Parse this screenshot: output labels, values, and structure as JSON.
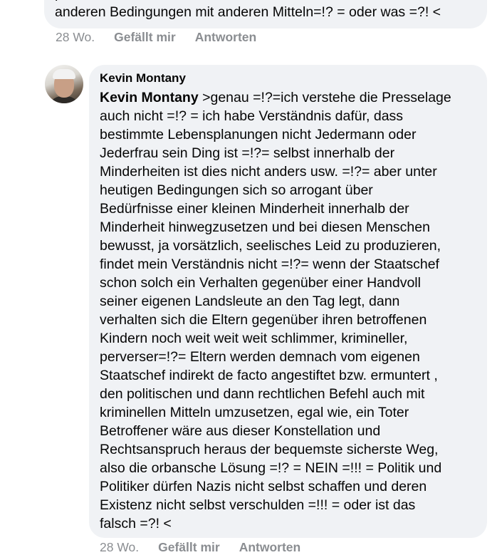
{
  "previous_comment": {
    "hidden_line": "p",
    "visible_line": "anderen Bedingungen mit anderen Mitteln=!? = oder was =?! <",
    "time": "28 Wo.",
    "like_label": "Gefällt mir",
    "reply_label": "Antworten"
  },
  "comment": {
    "author": "Kevin Montany",
    "mention": "Kevin Montany",
    "text": " >genau =!?=ich verstehe die Presselage\nauch nicht =!? = ich habe Verständnis dafür, dass\nbestimmte Lebensplanungen nicht Jedermann oder\nJederfrau sein Ding ist =!?= selbst innerhalb der\nMinderheiten ist dies nicht anders usw. =!?= aber  unter\nheutigen Bedingungen sich so arrogant über\nBedürfnisse einer kleinen Minderheit innerhalb der\nMinderheit hinwegzusetzen und bei diesen Menschen\nbewusst, ja  vorsätzlich, seelisches Leid zu produzieren,\nfindet mein Verständnis nicht =!?= wenn der Staatschef\nschon solch ein Verhalten gegenüber einer Handvoll\nseiner eigenen  Landsleute an den Tag legt, dann\nverhalten sich die Eltern gegenüber ihren betroffenen\nKindern noch weit weit weit schlimmer, krimineller,\nperverser=!?= Eltern werden demnach vom eigenen\nStaatschef indirekt de facto angestiftet bzw. ermuntert ,\nden politischen und dann rechtlichen Befehl auch mit\nkriminellen Mitteln  umzusetzen, egal wie, ein Toter\nBetroffener wäre aus dieser Konstellation und\nRechtsanspruch heraus der bequemste sicherste Weg,\nalso die orbansche Lösung =!? = NEIN =!!! = Politik  und\nPolitiker dürfen Nazis nicht selbst schaffen und deren\nExistenz nicht selbst verschulden =!!! = oder ist das\nfalsch =?! <",
    "time": "28 Wo.",
    "like_label": "Gefällt mir",
    "reply_label": "Antworten"
  },
  "colors": {
    "bubble_bg": "#f0f2f5",
    "meta_gray": "#8a8d91",
    "text": "#050505"
  }
}
